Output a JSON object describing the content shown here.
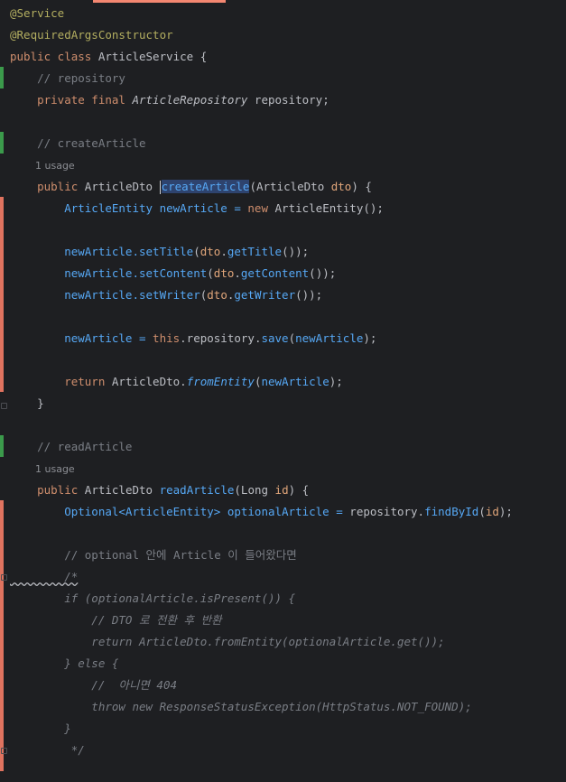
{
  "editor": {
    "lines": [
      {
        "id": "l1",
        "tokens": [
          {
            "t": "@Service",
            "c": "ann"
          }
        ]
      },
      {
        "id": "l2",
        "tokens": [
          {
            "t": "@RequiredArgsConstructor",
            "c": "ann"
          }
        ]
      },
      {
        "id": "l3",
        "tokens": [
          {
            "t": "public class ",
            "c": "k"
          },
          {
            "t": "ArticleService",
            "c": "ty"
          },
          {
            "t": " {",
            "c": ""
          }
        ]
      },
      {
        "id": "l4",
        "tokens": [
          {
            "t": "    // repository",
            "c": "cm"
          }
        ]
      },
      {
        "id": "l5",
        "tokens": [
          {
            "t": "    private final ",
            "c": "k"
          },
          {
            "t": "ArticleRepository",
            "c": "it"
          },
          {
            "t": " repository;",
            "c": ""
          }
        ]
      },
      {
        "id": "l6",
        "tokens": []
      },
      {
        "id": "l7",
        "tokens": [
          {
            "t": "    // createArticle",
            "c": "cm"
          }
        ]
      },
      {
        "id": "l8",
        "usage": "1 usage"
      },
      {
        "id": "l9",
        "tokens": [
          {
            "t": "    public ",
            "c": "k"
          },
          {
            "t": "ArticleDto ",
            "c": ""
          },
          {
            "t": "",
            "c": "caret"
          },
          {
            "t": "createArticle",
            "c": "fn hl"
          },
          {
            "t": "(ArticleDto ",
            "c": ""
          },
          {
            "t": "dto",
            "c": "par"
          },
          {
            "t": ") {",
            "c": ""
          }
        ]
      },
      {
        "id": "l10",
        "tokens": [
          {
            "t": "        ArticleEntity newArticle = ",
            "c": "fn"
          },
          {
            "t": "new ",
            "c": "k"
          },
          {
            "t": "ArticleEntity",
            "c": ""
          },
          {
            "t": "();",
            "c": ""
          }
        ]
      },
      {
        "id": "l11",
        "tokens": []
      },
      {
        "id": "l12",
        "tokens": [
          {
            "t": "        newArticle.",
            "c": "fn"
          },
          {
            "t": "setTitle",
            "c": "fn"
          },
          {
            "t": "(",
            "c": ""
          },
          {
            "t": "dto",
            "c": "par"
          },
          {
            "t": ".",
            "c": ""
          },
          {
            "t": "getTitle",
            "c": "fn"
          },
          {
            "t": "());",
            "c": ""
          }
        ]
      },
      {
        "id": "l13",
        "tokens": [
          {
            "t": "        newArticle.",
            "c": "fn"
          },
          {
            "t": "setContent",
            "c": "fn"
          },
          {
            "t": "(",
            "c": ""
          },
          {
            "t": "dto",
            "c": "par"
          },
          {
            "t": ".",
            "c": ""
          },
          {
            "t": "getContent",
            "c": "fn"
          },
          {
            "t": "());",
            "c": ""
          }
        ]
      },
      {
        "id": "l14",
        "tokens": [
          {
            "t": "        newArticle.",
            "c": "fn"
          },
          {
            "t": "setWriter",
            "c": "fn"
          },
          {
            "t": "(",
            "c": ""
          },
          {
            "t": "dto",
            "c": "par"
          },
          {
            "t": ".",
            "c": ""
          },
          {
            "t": "getWriter",
            "c": "fn"
          },
          {
            "t": "());",
            "c": ""
          }
        ]
      },
      {
        "id": "l15",
        "tokens": []
      },
      {
        "id": "l16",
        "tokens": [
          {
            "t": "        newArticle = ",
            "c": "fn"
          },
          {
            "t": "this",
            "c": "k"
          },
          {
            "t": ".repository.",
            "c": ""
          },
          {
            "t": "save",
            "c": "fn"
          },
          {
            "t": "(",
            "c": ""
          },
          {
            "t": "newArticle",
            "c": "fn"
          },
          {
            "t": ");",
            "c": ""
          }
        ]
      },
      {
        "id": "l17",
        "tokens": []
      },
      {
        "id": "l18",
        "tokens": [
          {
            "t": "        return ",
            "c": "k"
          },
          {
            "t": "ArticleDto.",
            "c": ""
          },
          {
            "t": "fromEntity",
            "c": "fn it"
          },
          {
            "t": "(",
            "c": ""
          },
          {
            "t": "newArticle",
            "c": "fn"
          },
          {
            "t": ");",
            "c": ""
          }
        ]
      },
      {
        "id": "l19",
        "tokens": [
          {
            "t": "    }",
            "c": ""
          }
        ]
      },
      {
        "id": "l20",
        "tokens": []
      },
      {
        "id": "l21",
        "tokens": [
          {
            "t": "    // readArticle",
            "c": "cm"
          }
        ]
      },
      {
        "id": "l22",
        "usage": "1 usage"
      },
      {
        "id": "l23",
        "tokens": [
          {
            "t": "    public ",
            "c": "k"
          },
          {
            "t": "ArticleDto ",
            "c": ""
          },
          {
            "t": "readArticle",
            "c": "fn"
          },
          {
            "t": "(Long ",
            "c": ""
          },
          {
            "t": "id",
            "c": "par"
          },
          {
            "t": ") {",
            "c": ""
          }
        ]
      },
      {
        "id": "l24",
        "tokens": [
          {
            "t": "        Optional<ArticleEntity> optionalArticle = ",
            "c": "fn"
          },
          {
            "t": "repository.",
            "c": ""
          },
          {
            "t": "findById",
            "c": "fn"
          },
          {
            "t": "(",
            "c": ""
          },
          {
            "t": "id",
            "c": "par"
          },
          {
            "t": ");",
            "c": ""
          }
        ]
      },
      {
        "id": "l25",
        "tokens": []
      },
      {
        "id": "l26",
        "tokens": [
          {
            "t": "        // optional 안에 Article 이 들어왔다면",
            "c": "cm"
          }
        ]
      },
      {
        "id": "l27",
        "tokens": [
          {
            "t": "        /*",
            "c": "cmblock squig"
          }
        ]
      },
      {
        "id": "l28",
        "tokens": [
          {
            "t": "        if (optionalArticle.isPresent()) {",
            "c": "cmblock"
          }
        ]
      },
      {
        "id": "l29",
        "tokens": [
          {
            "t": "            // DTO 로 전환 후 반환",
            "c": "cmblock"
          }
        ]
      },
      {
        "id": "l30",
        "tokens": [
          {
            "t": "            return ArticleDto.fromEntity(optionalArticle.get());",
            "c": "cmblock"
          }
        ]
      },
      {
        "id": "l31",
        "tokens": [
          {
            "t": "        } else {",
            "c": "cmblock"
          }
        ]
      },
      {
        "id": "l32",
        "tokens": [
          {
            "t": "            //  아니면 404",
            "c": "cmblock"
          }
        ]
      },
      {
        "id": "l33",
        "tokens": [
          {
            "t": "            throw new ResponseStatusException(HttpStatus.NOT_FOUND);",
            "c": "cmblock"
          }
        ]
      },
      {
        "id": "l34",
        "tokens": [
          {
            "t": "        }",
            "c": "cmblock"
          }
        ]
      },
      {
        "id": "l35",
        "tokens": [
          {
            "t": "         */",
            "c": "cmblock"
          }
        ]
      }
    ]
  },
  "gutter": {
    "added_color": "#3b9a4b",
    "modified_color": "#e0735f"
  },
  "colors": {
    "background": "#1e1f22",
    "keyword": "#cf8e6d",
    "annotation": "#b3ae60",
    "comment": "#7a7e85",
    "function": "#56a8f5",
    "parameter": "#e0a57a"
  }
}
